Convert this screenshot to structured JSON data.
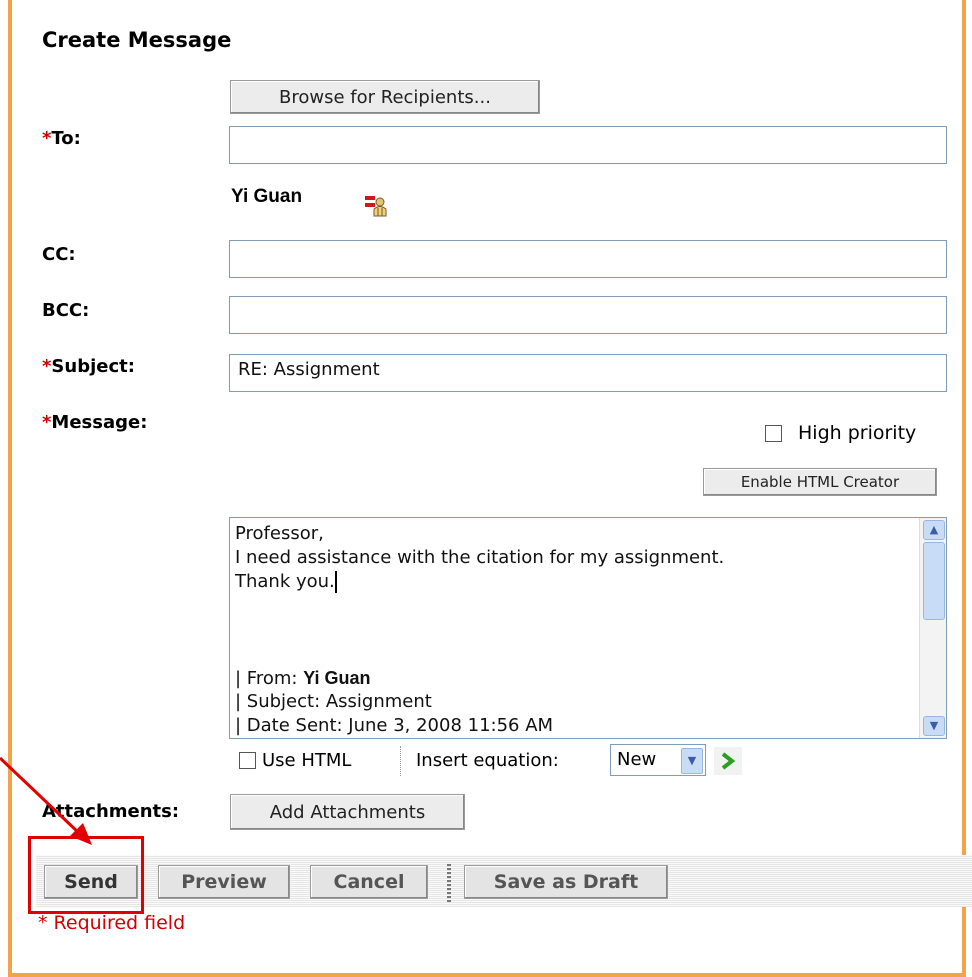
{
  "form": {
    "title": "Create Message",
    "browse_button": "Browse for Recipients...",
    "to_label": "To:",
    "to_value": "",
    "recipient_name": "Yi Guan",
    "cc_label": "CC:",
    "bcc_label": "BCC:",
    "subject_label": "Subject:",
    "subject_value": "RE: Assignment",
    "message_label": "Message:",
    "required_marker": "*",
    "high_priority_label": "High priority",
    "enable_html_button": "Enable HTML Creator",
    "message_body": {
      "line1": "Professor,",
      "line2": "I need assistance with the citation for my assignment.",
      "line3": "Thank you.",
      "from_label": "| From:",
      "from_name": "Yi Guan",
      "subject_line": "| Subject: Assignment",
      "date_line": "| Date Sent: June 3, 2008 11:56 AM"
    },
    "use_html_label": "Use HTML",
    "insert_equation_label": "Insert equation:",
    "equation_option": "New",
    "attachments_label": "Attachments:",
    "add_attachments_button": "Add Attachments"
  },
  "actions": {
    "send": "Send",
    "preview": "Preview",
    "cancel": "Cancel",
    "save_draft": "Save as Draft"
  },
  "footer": {
    "required_note": "* Required field"
  },
  "colors": {
    "frame": "#f4a34a",
    "required": "#d40000",
    "annotation": "#e00000"
  },
  "icons": {
    "recipient_icon": "remove-user-icon",
    "go_icon": "green-arrow-icon"
  }
}
